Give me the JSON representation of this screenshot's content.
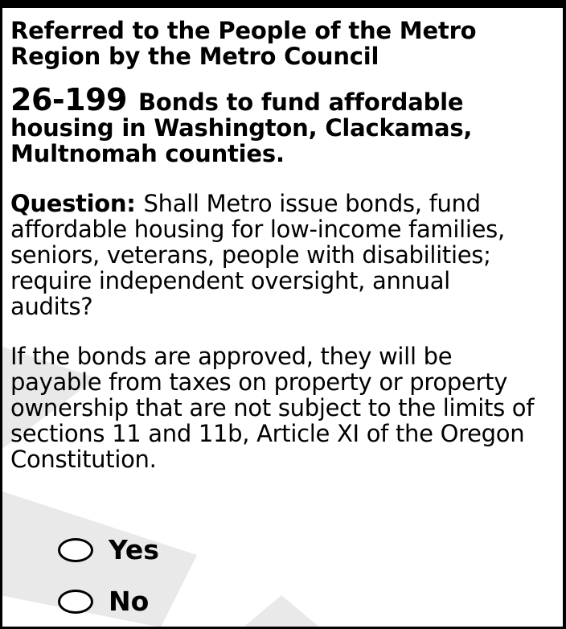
{
  "heading": {
    "line1": "Referred to the People of the Metro",
    "line2": "Region by the Metro Council"
  },
  "measure": {
    "number": "26-199",
    "title_line1": "Bonds to fund affordable",
    "title_line2": "housing in Washington, Clackamas,",
    "title_line3": "Multnomah counties."
  },
  "question": {
    "label": "Question:",
    "line1": "Shall Metro issue bonds, fund",
    "line2": "affordable housing for low-income families,",
    "line3": "seniors, veterans, people with disabilities;",
    "line4": "require independent oversight, annual",
    "line5": "audits?"
  },
  "bond_statement": {
    "line1": "If the bonds are approved, they will be",
    "line2": "payable from taxes on property or property",
    "line3": "ownership that are not subject to the limits of",
    "line4": "sections 11 and 11b, Article XI of the Oregon",
    "line5": "Constitution."
  },
  "options": {
    "yes_label": "Yes",
    "no_label": "No"
  },
  "colors": {
    "ink": "#000000",
    "watermark": "#e9e9e9",
    "paper": "#ffffff"
  }
}
